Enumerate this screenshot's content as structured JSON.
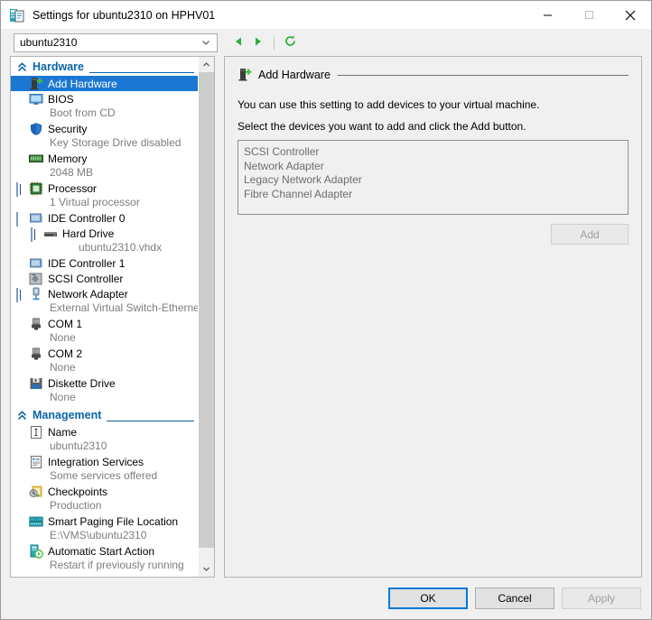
{
  "window": {
    "title": "Settings for ubuntu2310 on HPHV01",
    "icon": "vm-settings-icon",
    "minimize_label": "—",
    "maximize_label": "□",
    "close_label": "✕"
  },
  "toolbar": {
    "vm_selector": {
      "value": "ubuntu2310",
      "icon": "chevron-down-icon"
    },
    "back_icon": "back-triangle-icon",
    "forward_icon": "forward-triangle-icon",
    "refresh_icon": "refresh-icon"
  },
  "tree": {
    "sections": [
      {
        "title": "Hardware",
        "collapse_icon": "double-chevron-up-icon",
        "items": [
          {
            "label": "Add Hardware",
            "sub": null,
            "icon": "add-hardware-icon",
            "expander": "none",
            "indent": 1,
            "selected": true
          },
          {
            "label": "BIOS",
            "sub": "Boot from CD",
            "icon": "bios-monitor-icon",
            "expander": "none",
            "indent": 1,
            "selected": false
          },
          {
            "label": "Security",
            "sub": "Key Storage Drive disabled",
            "icon": "security-shield-icon",
            "expander": "none",
            "indent": 1,
            "selected": false
          },
          {
            "label": "Memory",
            "sub": "2048 MB",
            "icon": "memory-icon",
            "expander": "none",
            "indent": 1,
            "selected": false
          },
          {
            "label": "Processor",
            "sub": "1 Virtual processor",
            "icon": "processor-icon",
            "expander": "plus",
            "indent": 1,
            "selected": false
          },
          {
            "label": "IDE Controller 0",
            "sub": null,
            "icon": "ide-controller-icon",
            "expander": "minus",
            "indent": 1,
            "selected": false
          },
          {
            "label": "Hard Drive",
            "sub": "ubuntu2310.vhdx",
            "icon": "hard-drive-icon",
            "expander": "plus",
            "indent": 2,
            "selected": false
          },
          {
            "label": "IDE Controller 1",
            "sub": null,
            "icon": "ide-controller-icon",
            "expander": "none",
            "indent": 1,
            "selected": false
          },
          {
            "label": "SCSI Controller",
            "sub": null,
            "icon": "scsi-controller-icon",
            "expander": "none",
            "indent": 1,
            "selected": false
          },
          {
            "label": "Network Adapter",
            "sub": "External Virtual Switch-Ethernet",
            "icon": "network-adapter-icon",
            "expander": "plus",
            "indent": 1,
            "selected": false
          },
          {
            "label": "COM 1",
            "sub": "None",
            "icon": "com-port-icon",
            "expander": "none",
            "indent": 1,
            "selected": false
          },
          {
            "label": "COM 2",
            "sub": "None",
            "icon": "com-port-icon",
            "expander": "none",
            "indent": 1,
            "selected": false
          },
          {
            "label": "Diskette Drive",
            "sub": "None",
            "icon": "diskette-drive-icon",
            "expander": "none",
            "indent": 1,
            "selected": false
          }
        ]
      },
      {
        "title": "Management",
        "collapse_icon": "double-chevron-up-icon",
        "items": [
          {
            "label": "Name",
            "sub": "ubuntu2310",
            "icon": "name-icon",
            "expander": "none",
            "indent": 1,
            "selected": false
          },
          {
            "label": "Integration Services",
            "sub": "Some services offered",
            "icon": "integration-services-icon",
            "expander": "none",
            "indent": 1,
            "selected": false
          },
          {
            "label": "Checkpoints",
            "sub": "Production",
            "icon": "checkpoints-icon",
            "expander": "none",
            "indent": 1,
            "selected": false
          },
          {
            "label": "Smart Paging File Location",
            "sub": "E:\\VMS\\ubuntu2310",
            "icon": "smart-paging-icon",
            "expander": "none",
            "indent": 1,
            "selected": false
          },
          {
            "label": "Automatic Start Action",
            "sub": "Restart if previously running",
            "icon": "automatic-start-icon",
            "expander": "none",
            "indent": 1,
            "selected": false
          }
        ]
      }
    ],
    "scroll_up_icon": "chevron-up-icon",
    "scroll_down_icon": "chevron-down-icon"
  },
  "panel": {
    "title": "Add Hardware",
    "icon": "add-hardware-icon",
    "description_line1": "You can use this setting to add devices to your virtual machine.",
    "description_line2": "Select the devices you want to add and click the Add button.",
    "devices": [
      "SCSI Controller",
      "Network Adapter",
      "Legacy Network Adapter",
      "Fibre Channel Adapter"
    ],
    "add_button": "Add"
  },
  "footer": {
    "ok": "OK",
    "cancel": "Cancel",
    "apply": "Apply"
  },
  "colors": {
    "accent": "#0078d7",
    "section_blue": "#0964a8",
    "selection": "#1b77d4",
    "nav_green": "#2fac3f"
  }
}
